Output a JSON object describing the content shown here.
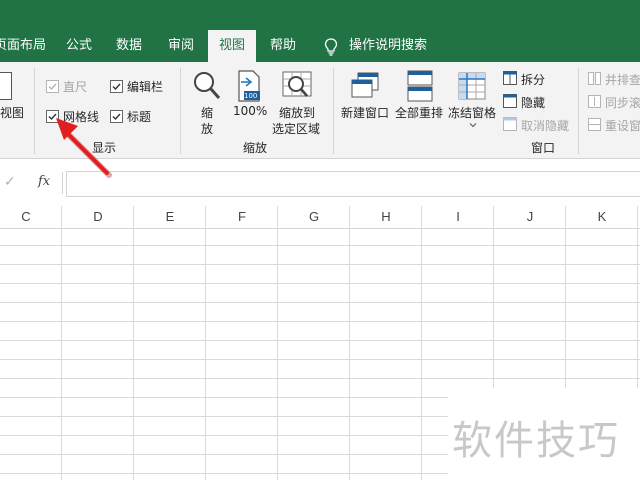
{
  "tabs": [
    {
      "label": "页面布局",
      "active": false
    },
    {
      "label": "公式",
      "active": false
    },
    {
      "label": "数据",
      "active": false
    },
    {
      "label": "审阅",
      "active": false
    },
    {
      "label": "视图",
      "active": true
    },
    {
      "label": "帮助",
      "active": false
    }
  ],
  "tell_me": {
    "icon": "lightbulb-icon",
    "label": "操作说明搜索"
  },
  "ribbon": {
    "workbook_views": {
      "partial_label": "视图"
    },
    "show": {
      "group_label": "显示",
      "ruler": {
        "label": "直尺",
        "checked": true,
        "disabled": true
      },
      "formula_bar": {
        "label": "编辑栏",
        "checked": true
      },
      "gridlines": {
        "label": "网格线",
        "checked": true
      },
      "headings": {
        "label": "标题",
        "checked": true
      }
    },
    "zoom": {
      "group_label": "缩放",
      "zoom_label": "缩\n放",
      "zoom_line1": "缩",
      "zoom_line2": "放",
      "hundred_label": "100%",
      "hundred_icon_text": "100",
      "selection_line1": "缩放到",
      "selection_line2": "选定区域"
    },
    "window": {
      "group_label": "窗口",
      "new_window": "新建窗口",
      "arrange_all": "全部重排",
      "freeze_panes": "冻结窗格",
      "split": "拆分",
      "hide": "隐藏",
      "unhide": "取消隐藏",
      "side_by_side": "并排查",
      "sync_scroll": "同步滚",
      "reset_position": "重设窗"
    }
  },
  "formula_bar": {
    "check_symbol": "✓",
    "fx_label": "fx"
  },
  "columns": [
    "C",
    "D",
    "E",
    "F",
    "G",
    "H",
    "I",
    "J",
    "K"
  ],
  "watermark": "软件技巧",
  "colors": {
    "brand": "#217346",
    "arrow": "#e02020"
  }
}
